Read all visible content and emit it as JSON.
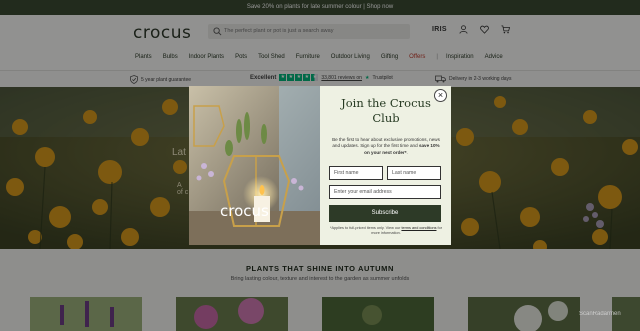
{
  "promo_bar": {
    "text": "Save 20% on plants for late summer colour | Shop now"
  },
  "header": {
    "logo": "crocus",
    "search_placeholder": "The perfect plant or pot is just a search away",
    "iris_label": "IRIS"
  },
  "nav": {
    "items": [
      "Plants",
      "Bulbs",
      "Indoor Plants",
      "Pots",
      "Tool Shed",
      "Furniture",
      "Outdoor Living",
      "Gifting",
      "Offers"
    ],
    "separator": "|",
    "secondary": [
      "Inspiration",
      "Advice"
    ]
  },
  "trust_bar": {
    "guarantee": "5 year plant guarantee",
    "rating_word": "Excellent",
    "reviews": "33,801 reviews on",
    "trustpilot": "Trustpilot",
    "delivery": "Delivery in 2-3 working days",
    "star_color": "#00b67a",
    "rating_stars": 4.5
  },
  "hero": {
    "text_line1": "Lat",
    "text_line2": "A",
    "text_line3": "of c"
  },
  "section": {
    "title": "PLANTS THAT SHINE INTO AUTUMN",
    "subtitle": "Bring lasting colour, texture and interest to the garden as summer unfolds"
  },
  "modal": {
    "image_logo": "crocus",
    "title": "Join the Crocus Club",
    "body_text": "Be the first to hear about exclusive promotions, news and updates. Sign up for the first time and",
    "body_bold": "save 10% on your next order*",
    "body_end": ".",
    "first_name_placeholder": "First name",
    "last_name_placeholder": "Last name",
    "email_placeholder": "Enter your email address",
    "subscribe_label": "Subscribe",
    "terms_prefix": "*Applies to full-priced items only. View our",
    "terms_link": "terms and conditions",
    "terms_suffix": "for more information.",
    "close_symbol": "×"
  },
  "watermark": "ScanRadarmen",
  "colors": {
    "brand_dark": "#2d3a27",
    "promo_bg": "#3b4b33",
    "offers": "#c0392b",
    "modal_bg": "#eef1e3"
  }
}
